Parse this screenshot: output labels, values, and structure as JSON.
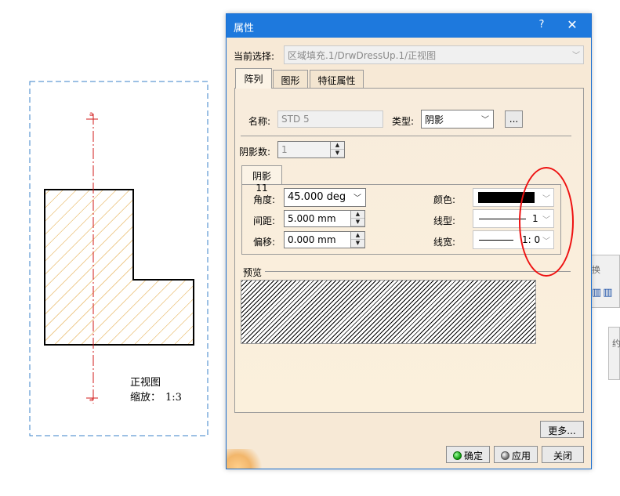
{
  "drawing": {
    "view_name": "正视图",
    "scale_label": "缩放：",
    "scale_value": "1:3"
  },
  "dialog": {
    "title": "属性",
    "help_glyph": "?",
    "close_glyph": "✕",
    "current_selection_label": "当前选择:",
    "current_selection_value": "区域填充.1/DrwDressUp.1/正视图",
    "tabs": [
      {
        "label": "阵列",
        "active": true
      },
      {
        "label": "图形",
        "active": false
      },
      {
        "label": "特征属性",
        "active": false
      }
    ],
    "name_label": "名称:",
    "name_value": "STD 5",
    "type_label": "类型:",
    "type_value": "阴影",
    "ellipsis_label": "...",
    "hatch_count_label": "阴影数:",
    "hatch_count_value": "1",
    "hatch_tab_label": "阴影11",
    "angle_label": "角度:",
    "angle_value": "45.000 deg",
    "spacing_label": "间距:",
    "spacing_value": "5.000 mm",
    "offset_label": "偏移:",
    "offset_value": "0.000 mm",
    "color_label": "颜色:",
    "color_value": "#000000",
    "linetype_label": "线型:",
    "linetype_value": "1",
    "linewidth_label": "线宽:",
    "linewidth_value": "1: 0",
    "preview_label": "预览",
    "more_label": "更多...",
    "ok_label": "确定",
    "apply_label": "应用",
    "close_label": "关闭"
  },
  "background": {
    "win1_label": "换",
    "win2_label": "约"
  },
  "colors": {
    "titlebar": "#1e79dd",
    "dialog_bg": "#f7e9d6",
    "hatch_fill": "#e0a030",
    "annotation": "#e11111",
    "axis_line": "#d21a1a"
  }
}
